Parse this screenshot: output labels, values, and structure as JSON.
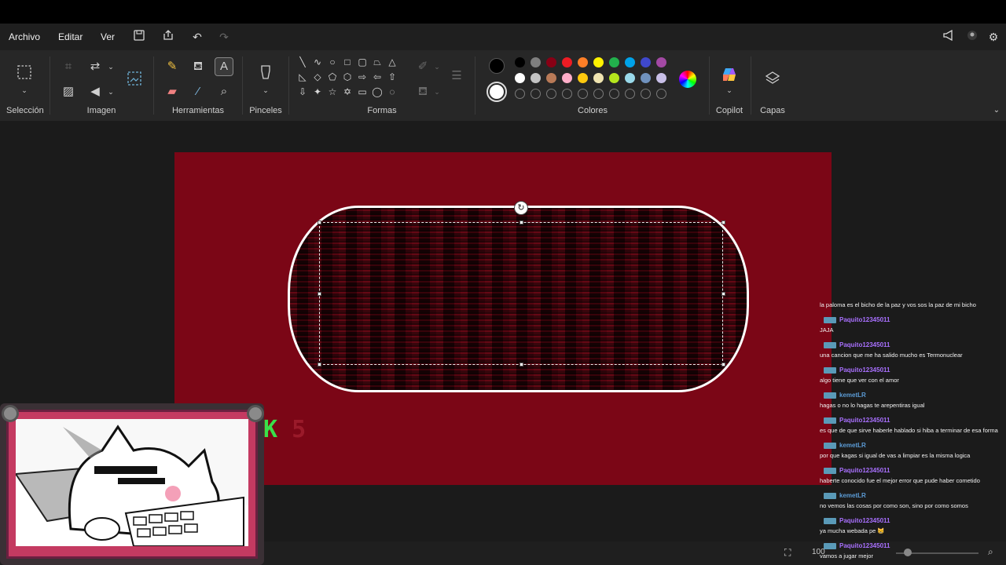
{
  "menu": {
    "archivo": "Archivo",
    "editar": "Editar",
    "ver": "Ver"
  },
  "ribbon": {
    "seleccion": "Selección",
    "imagen": "Imagen",
    "herramientas": "Herramientas",
    "pinceles": "Pinceles",
    "formas": "Formas",
    "colores": "Colores",
    "copilot": "Copilot",
    "capas": "Capas"
  },
  "colors": {
    "row1": [
      "#000000",
      "#7f7f7f",
      "#880015",
      "#ed1c24",
      "#ff7f27",
      "#fff200",
      "#22b14c",
      "#00a2e8",
      "#3f48cc",
      "#a349a4"
    ],
    "row2": [
      "#ffffff",
      "#c3c3c3",
      "#b97a57",
      "#ffaec9",
      "#ffc90e",
      "#efe4b0",
      "#b5e61d",
      "#99d9ea",
      "#7092be",
      "#c8bfe7"
    ],
    "primary": "#000000",
    "secondary": "#ffffff",
    "canvas": "#7b0616"
  },
  "overlay": {
    "k": "K",
    "five": "5"
  },
  "status": {
    "zoom": "100"
  },
  "chat": [
    {
      "user": "",
      "text": "la paloma es el bicho de la paz y vos sos la paz de mi bicho",
      "color": ""
    },
    {
      "user": "Paquito12345011",
      "text": "JAJA",
      "color": "#a970ff"
    },
    {
      "user": "Paquito12345011",
      "text": "una cancion que me ha salido mucho es Termonuclear",
      "color": "#a970ff"
    },
    {
      "user": "Paquito12345011",
      "text": "algo tiene que ver con el amor",
      "color": "#a970ff"
    },
    {
      "user": "kemetLR",
      "text": "hagas o no lo hagas te arepentiras igual",
      "color": "#5b9bd5"
    },
    {
      "user": "Paquito12345011",
      "text": "es que de que sirve haberle hablado si hiba a terminar de esa forma",
      "color": "#a970ff"
    },
    {
      "user": "kemetLR",
      "text": "por que kagas si igual de vas a limpiar es la misma logica",
      "color": "#5b9bd5"
    },
    {
      "user": "Paquito12345011",
      "text": "haberte conocido fue el mejor error que pude haber cometido",
      "color": "#a970ff"
    },
    {
      "user": "kemetLR",
      "text": "no vemos las cosas por como son, sino por como somos",
      "color": "#5b9bd5"
    },
    {
      "user": "Paquito12345011",
      "text": "ya mucha webada pe 😸",
      "color": "#a970ff"
    },
    {
      "user": "Paquito12345011",
      "text": "vamos a jugar mejor",
      "color": "#a970ff"
    }
  ]
}
